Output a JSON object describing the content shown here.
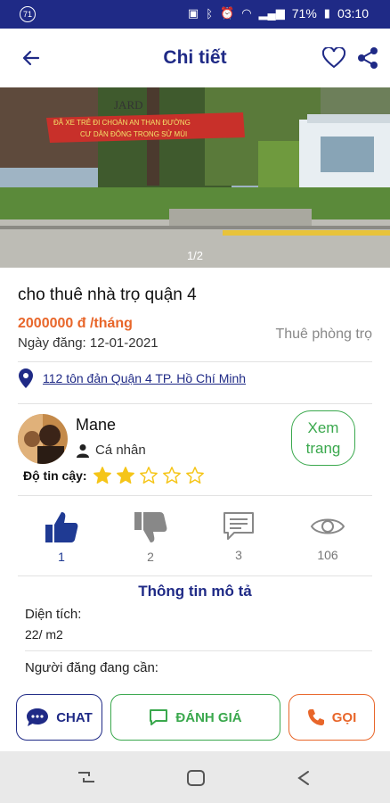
{
  "status_bar": {
    "notification_count": "71",
    "battery": "71%",
    "time": "03:10"
  },
  "header": {
    "title": "Chi tiết"
  },
  "photo": {
    "counter": "1/2",
    "banner_line1": "ĐÃ XE TRẺ ĐI CHOÁN AN THAN ĐƯỜNG",
    "banner_line2": "CƯ DÂN ĐÔNG TRONG SỬ MÙI",
    "sign": "JARD"
  },
  "listing": {
    "title": "cho thuê nhà trọ quận 4",
    "price": "2000000 đ  /tháng",
    "date_label": "Ngày đăng:",
    "date_value": "12-01-2021",
    "category": "Thuê phòng trọ",
    "address": "112 tôn đản  Quận 4 TP. Hồ Chí Minh"
  },
  "owner": {
    "name": "Mane",
    "type": "Cá nhân",
    "trust_label": "Độ tin cậy:",
    "rating": 2,
    "rating_max": 5,
    "view_page_line1": "Xem",
    "view_page_line2": "trang"
  },
  "stats": {
    "likes": "1",
    "dislikes": "2",
    "comments": "3",
    "views": "106"
  },
  "description": {
    "title": "Thông tin mô tả",
    "area_label": "Diện tích:",
    "area_value": "22/ m2",
    "needs_label": "Người đăng đang cần:"
  },
  "actions": {
    "chat": "CHAT",
    "rate": "ĐÁNH GIÁ",
    "call": "GỌI"
  },
  "colors": {
    "brand": "#1f2a86",
    "green": "#3aa84d",
    "orange": "#e8662a",
    "star": "#f5c518"
  }
}
